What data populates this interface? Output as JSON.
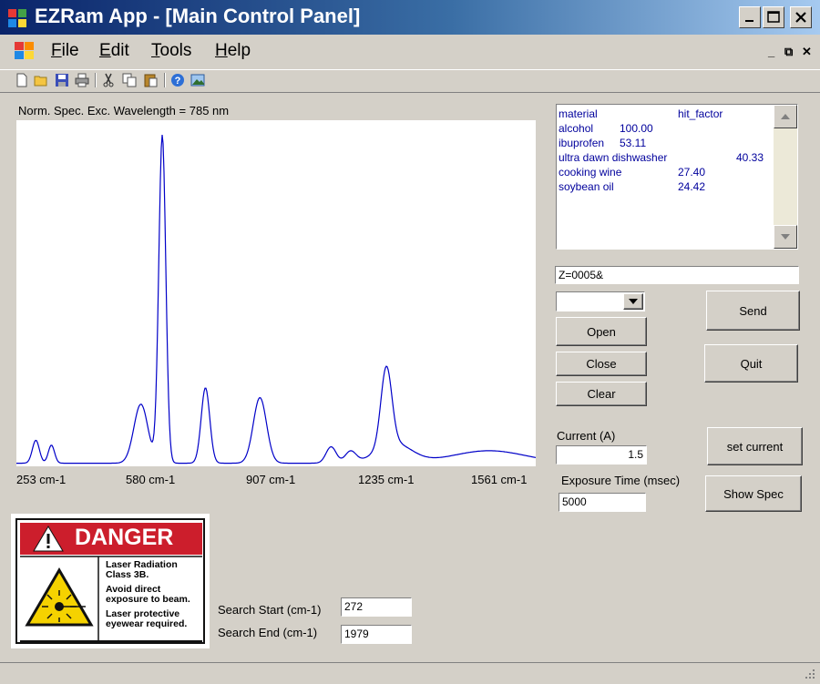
{
  "window": {
    "title": "EZRam App - [Main Control Panel]",
    "controls": {
      "minimize": "_",
      "maximize": "□",
      "close": "✕"
    }
  },
  "menu": {
    "items": [
      {
        "label_first": "F",
        "label_rest": "ile"
      },
      {
        "label_first": "E",
        "label_rest": "dit"
      },
      {
        "label_first": "T",
        "label_rest": "ools"
      },
      {
        "label_first": "H",
        "label_rest": "elp"
      }
    ],
    "mdi_min": "_",
    "mdi_restore": "⧉",
    "mdi_close": "✕"
  },
  "toolbar": {
    "icons": [
      "new-file-icon",
      "open-folder-icon",
      "save-icon",
      "print-icon",
      "cut-icon",
      "copy-icon",
      "paste-icon",
      "help-icon",
      "image-icon"
    ]
  },
  "chart": {
    "title": "Norm. Spec. Exc. Wavelength = 785 nm",
    "x_ticks": [
      "253 cm-1",
      "580 cm-1",
      "907 cm-1",
      "1235 cm-1",
      "1561 cm-1"
    ],
    "line_color": "#0000c8"
  },
  "chart_data": {
    "type": "line",
    "title": "Norm. Spec. Exc. Wavelength = 785 nm",
    "xlabel": "",
    "ylabel": "",
    "xlim": [
      240,
      1575
    ],
    "x_unit": "cm-1",
    "peaks": [
      {
        "center": 290,
        "height": 0.07,
        "width": 9
      },
      {
        "center": 330,
        "height": 0.055,
        "width": 8
      },
      {
        "center": 560,
        "height": 0.18,
        "width": 18
      },
      {
        "center": 615,
        "height": 1.0,
        "width": 9
      },
      {
        "center": 726,
        "height": 0.23,
        "width": 11
      },
      {
        "center": 866,
        "height": 0.2,
        "width": 17
      },
      {
        "center": 1049,
        "height": 0.05,
        "width": 13
      },
      {
        "center": 1099,
        "height": 0.035,
        "width": 14
      },
      {
        "center": 1191,
        "height": 0.24,
        "width": 14
      },
      {
        "center": 1210,
        "height": 0.06,
        "width": 45
      },
      {
        "center": 1455,
        "height": 0.038,
        "width": 95
      }
    ],
    "baseline": 0.004
  },
  "results": {
    "header": {
      "material": "material",
      "hit": "hit_factor"
    },
    "rows": [
      {
        "material": "alcohol",
        "hit": "100.00"
      },
      {
        "material": "ibuprofen",
        "hit": "53.11"
      },
      {
        "material": "ultra dawn dishwasher",
        "hit": "40.33"
      },
      {
        "material": "cooking wine",
        "hit": "27.40"
      },
      {
        "material": "soybean oil",
        "hit": "24.42"
      }
    ]
  },
  "command": {
    "value": "Z=0005&"
  },
  "port_select": {
    "value": ""
  },
  "buttons": {
    "send": "Send",
    "open": "Open",
    "quit": "Quit",
    "close": "Close",
    "clear": "Clear",
    "set_current": "set current",
    "show_spec": "Show Spec"
  },
  "current": {
    "label": "Current (A)",
    "value": "1.5"
  },
  "exposure": {
    "label": "Exposure Time (msec)",
    "value": "5000"
  },
  "search": {
    "start_label": "Search Start (cm-1)",
    "start_value": "272",
    "end_label": "Search End (cm-1)",
    "end_value": "1979"
  },
  "danger_sign": {
    "header": "DANGER",
    "line1": "Laser Radiation",
    "line2": "Class 3B.",
    "line3": "Avoid direct",
    "line4": "exposure to beam.",
    "line5": "Laser protective",
    "line6": "eyewear required.",
    "accent": "#cc1e2c"
  }
}
